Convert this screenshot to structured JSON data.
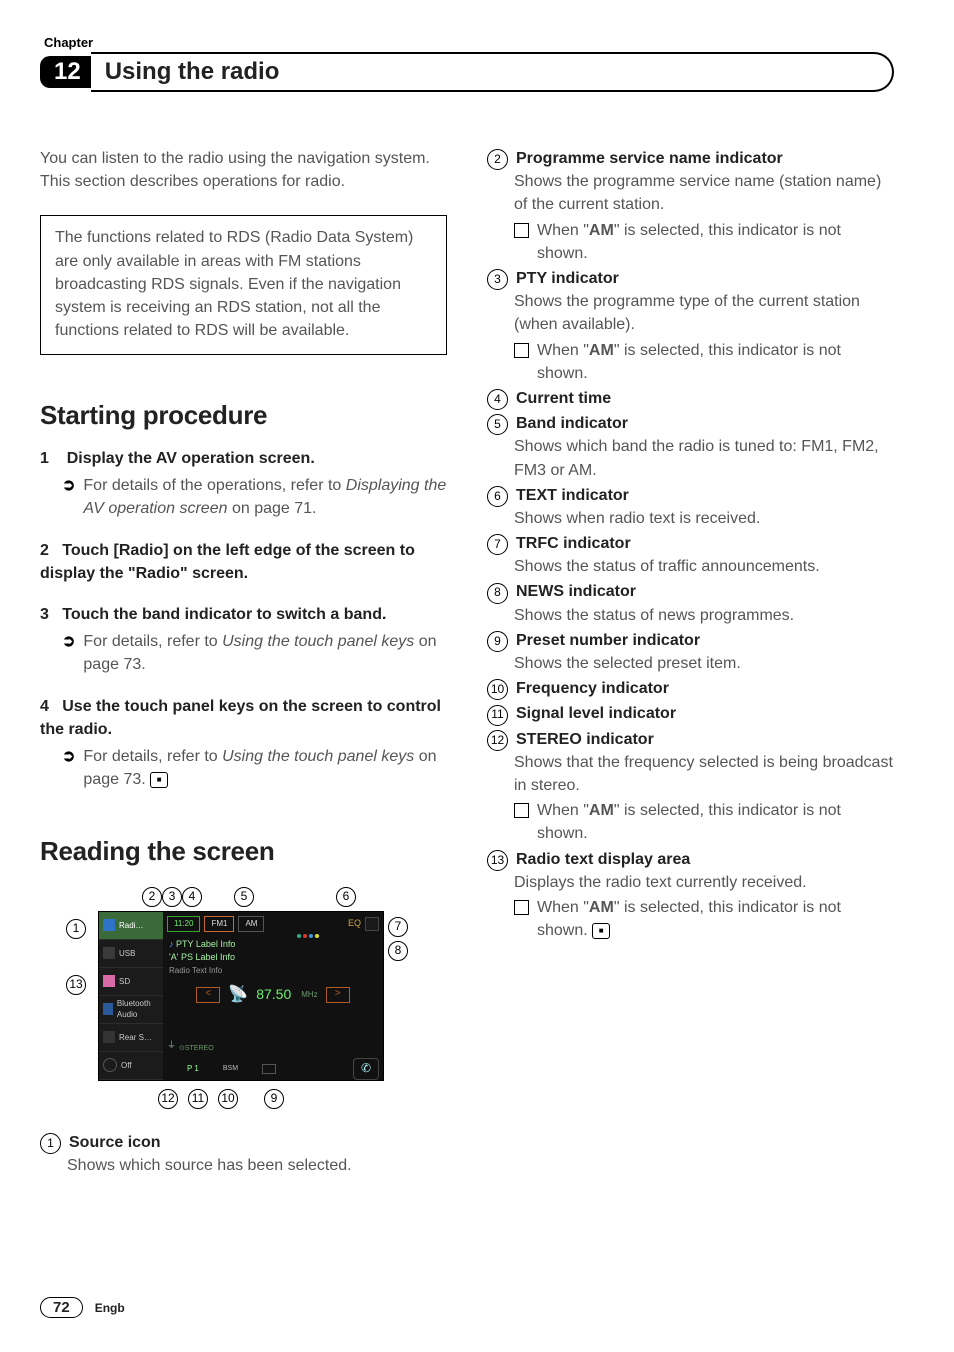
{
  "header": {
    "chapter_label": "Chapter",
    "chapter_number": "12",
    "title": "Using the radio"
  },
  "left": {
    "intro": "You can listen to the radio using the navigation system. This section describes operations for radio.",
    "note_box": "The functions related to RDS (Radio Data System) are only available in areas with FM stations broadcasting RDS signals. Even if the navigation system is receiving an RDS station, not all the functions related to RDS will be available.",
    "section1_heading": "Starting procedure",
    "step1_num": "1",
    "step1_title": "Display the AV operation screen.",
    "step1_sub_prefix": "For details of the operations, refer to ",
    "step1_sub_italic": "Displaying the AV operation screen",
    "step1_sub_suffix": " on page 71.",
    "step2_num": "2",
    "step2_title": "Touch [Radio] on the left edge of the screen to display the \"Radio\" screen.",
    "step3_num": "3",
    "step3_title": "Touch the band indicator to switch a band.",
    "step3_sub_prefix": "For details, refer to ",
    "step3_sub_italic": "Using the touch panel keys",
    "step3_sub_suffix": " on page 73.",
    "step4_num": "4",
    "step4_title": "Use the touch panel keys on the screen to control the radio.",
    "step4_sub_prefix": "For details, refer to ",
    "step4_sub_italic": "Using the touch panel keys",
    "step4_sub_suffix": " on page 73.",
    "section2_heading": "Reading the screen",
    "screenshot": {
      "src_radio": "Radi…",
      "src_usb": "USB",
      "src_sd": "SD",
      "src_bt": "Bluetooth Audio",
      "src_rear": "Rear S…",
      "src_off": "Off",
      "time": "11:20",
      "band_fm": "FM1",
      "band_am": "AM",
      "eq": "EQ",
      "pty": "PTY Label Info",
      "ps": "'A' PS Label Info",
      "rt": "Radio Text Info",
      "stereo": "⊙STEREO",
      "freq": "87.50",
      "mhz": "MHz",
      "preset": "P 1",
      "bsm": "BSM"
    },
    "item1_num": "1",
    "item1_title": "Source icon",
    "item1_body": "Shows which source has been selected."
  },
  "right": {
    "i2_num": "2",
    "i2_title": "Programme service name indicator",
    "i2_body": "Shows the programme service name (station name) of the current station.",
    "i2_note_prefix": "When \"",
    "i2_note_bold": "AM",
    "i2_note_suffix": "\" is selected, this indicator is not shown.",
    "i3_num": "3",
    "i3_title": "PTY indicator",
    "i3_body": "Shows the programme type of the current station (when available).",
    "i3_note_prefix": "When \"",
    "i3_note_bold": "AM",
    "i3_note_suffix": "\" is selected, this indicator is not shown.",
    "i4_num": "4",
    "i4_title": "Current time",
    "i5_num": "5",
    "i5_title": "Band indicator",
    "i5_body": "Shows which band the radio is tuned to: FM1, FM2, FM3 or AM.",
    "i6_num": "6",
    "i6_title": "TEXT indicator",
    "i6_body": "Shows when radio text is received.",
    "i7_num": "7",
    "i7_title": "TRFC indicator",
    "i7_body": "Shows the status of traffic announcements.",
    "i8_num": "8",
    "i8_title": "NEWS indicator",
    "i8_body": "Shows the status of news programmes.",
    "i9_num": "9",
    "i9_title": "Preset number indicator",
    "i9_body": "Shows the selected preset item.",
    "i10_num": "10",
    "i10_title": "Frequency indicator",
    "i11_num": "11",
    "i11_title": "Signal level indicator",
    "i12_num": "12",
    "i12_title": "STEREO indicator",
    "i12_body": "Shows that the frequency selected is being broadcast in stereo.",
    "i12_note_prefix": "When \"",
    "i12_note_bold": "AM",
    "i12_note_suffix": "\" is selected, this indicator is not shown.",
    "i13_num": "13",
    "i13_title": "Radio text display area",
    "i13_body": "Displays the radio text currently received.",
    "i13_note_prefix": "When \"",
    "i13_note_bold": "AM",
    "i13_note_suffix": "\" is selected, this indicator is not shown."
  },
  "callouts": {
    "c1": "1",
    "c2": "2",
    "c3": "3",
    "c4": "4",
    "c5": "5",
    "c6": "6",
    "c7": "7",
    "c8": "8",
    "c9": "9",
    "c10": "10",
    "c11": "11",
    "c12": "12",
    "c13": "13"
  },
  "footer": {
    "page_number": "72",
    "language": "Engb"
  }
}
